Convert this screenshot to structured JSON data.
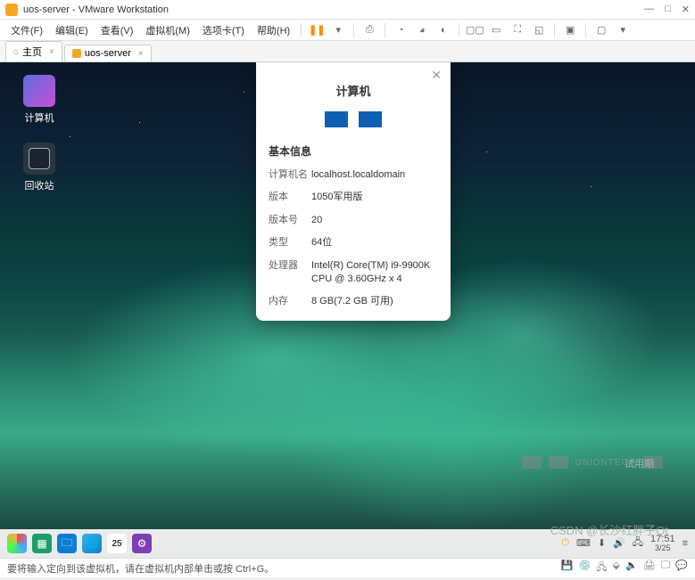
{
  "window": {
    "title": "uos-server - VMware Workstation",
    "minimize": "—",
    "maximize": "□",
    "close": "✕"
  },
  "menu": {
    "file": "文件(F)",
    "edit": "编辑(E)",
    "view": "查看(V)",
    "vm": "虚拟机(M)",
    "tabs": "选项卡(T)",
    "help": "帮助(H)"
  },
  "tabs": {
    "home": "主页",
    "vm": "uos-server"
  },
  "desktop": {
    "computer": "计算机",
    "trash": "回收站"
  },
  "dialog": {
    "title": "计算机",
    "section": "基本信息",
    "rows": {
      "hostname_k": "计算机名",
      "hostname_v": "localhost.localdomain",
      "version_k": "版本",
      "version_v": "1050军用版",
      "build_k": "版本号",
      "build_v": "20",
      "type_k": "类型",
      "type_v": "64位",
      "cpu_k": "处理器",
      "cpu_v": "Intel(R) Core(TM) i9-9900K CPU @ 3.60GHz x 4",
      "mem_k": "内存",
      "mem_v": "8 GB(7.2 GB 可用)"
    }
  },
  "watermark": {
    "brand": "UNIONTECH",
    "trial": "试用期"
  },
  "taskbar": {
    "date_badge": "25",
    "time": "17:51",
    "date": "3/25"
  },
  "status": {
    "hint": "要将输入定向到该虚拟机，请在虚拟机内部单击或按 Ctrl+G。"
  },
  "csdn": "CSDN @长沙红胖子Qt"
}
